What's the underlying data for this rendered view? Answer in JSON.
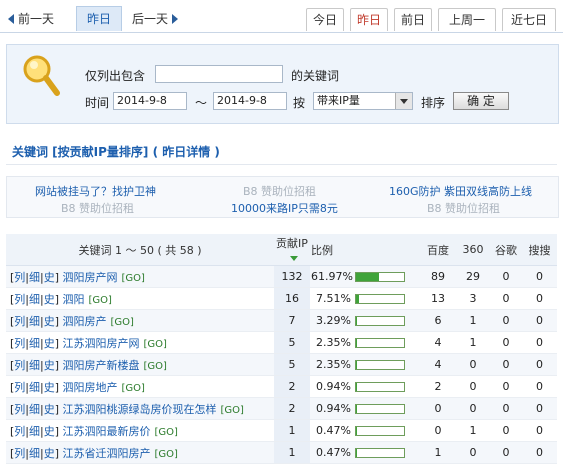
{
  "daynav": {
    "prev_label": "前一天",
    "current_label": "昨日",
    "next_label": "后一天"
  },
  "tabs": [
    "今日",
    "昨日",
    "前日",
    "上周一",
    "近七日"
  ],
  "active_tab": "昨日",
  "search": {
    "contains_label": "仅列出包含",
    "keyword_value": "",
    "keyword_suffix": "的关键词",
    "time_label": "时间",
    "date_from": "2014-9-8",
    "range_sep": "～",
    "date_to": "2014-9-8",
    "by_label": "按",
    "sort_select_value": "带来IP量",
    "order_label": "排序",
    "confirm_label": "确 定"
  },
  "section_title": "关键词 [按贡献IP量排序] ( 昨日详情 )",
  "ads": {
    "link1": "网站被挂马了？找护卫神",
    "gray1": "B8 赞助位招租",
    "link2": "160G防护 紫田双线高防上线",
    "gray2": "B8 赞助位招租",
    "link3": "10000来路IP只需8元",
    "gray3": "B8 赞助位招租"
  },
  "table": {
    "headers": {
      "keyword": "关键词 1 ～ 50 ( 共 58 )",
      "ip": "贡献IP",
      "ratio": "比例",
      "baidu": "百度",
      "s360": "360",
      "google": "谷歌",
      "sogou": "搜搜"
    },
    "row_actions": [
      "列",
      "细",
      "史"
    ],
    "go_label": "[GO]",
    "rows": [
      {
        "keyword": "泗阳房产网",
        "ip": "132",
        "pct": "61.97%",
        "ratio": 0.6197,
        "baidu": "89",
        "s360": "29",
        "google": "0",
        "sogou": "0"
      },
      {
        "keyword": "泗阳",
        "ip": "16",
        "pct": "7.51%",
        "ratio": 0.0751,
        "baidu": "13",
        "s360": "3",
        "google": "0",
        "sogou": "0"
      },
      {
        "keyword": "泗阳房产",
        "ip": "7",
        "pct": "3.29%",
        "ratio": 0.0329,
        "baidu": "6",
        "s360": "1",
        "google": "0",
        "sogou": "0"
      },
      {
        "keyword": "江苏泗阳房产网",
        "ip": "5",
        "pct": "2.35%",
        "ratio": 0.0235,
        "baidu": "4",
        "s360": "1",
        "google": "0",
        "sogou": "0"
      },
      {
        "keyword": "泗阳房产新楼盘",
        "ip": "5",
        "pct": "2.35%",
        "ratio": 0.0235,
        "baidu": "4",
        "s360": "0",
        "google": "0",
        "sogou": "0"
      },
      {
        "keyword": "泗阳房地产",
        "ip": "2",
        "pct": "0.94%",
        "ratio": 0.0094,
        "baidu": "2",
        "s360": "0",
        "google": "0",
        "sogou": "0"
      },
      {
        "keyword": "江苏泗阳桃源绿岛房价现在怎样",
        "ip": "2",
        "pct": "0.94%",
        "ratio": 0.0094,
        "baidu": "0",
        "s360": "0",
        "google": "0",
        "sogou": "0"
      },
      {
        "keyword": "江苏泗阳最新房价",
        "ip": "1",
        "pct": "0.47%",
        "ratio": 0.0047,
        "baidu": "0",
        "s360": "1",
        "google": "0",
        "sogou": "0"
      },
      {
        "keyword": "江苏省迁泗阳房产",
        "ip": "1",
        "pct": "0.47%",
        "ratio": 0.0047,
        "baidu": "1",
        "s360": "0",
        "google": "0",
        "sogou": "0"
      }
    ]
  },
  "colors": {
    "link": "#1d5fae",
    "bar_fill": "#3fa33a",
    "active_tab_text": "#c0392b",
    "panel_bg": "#eef4fb"
  }
}
